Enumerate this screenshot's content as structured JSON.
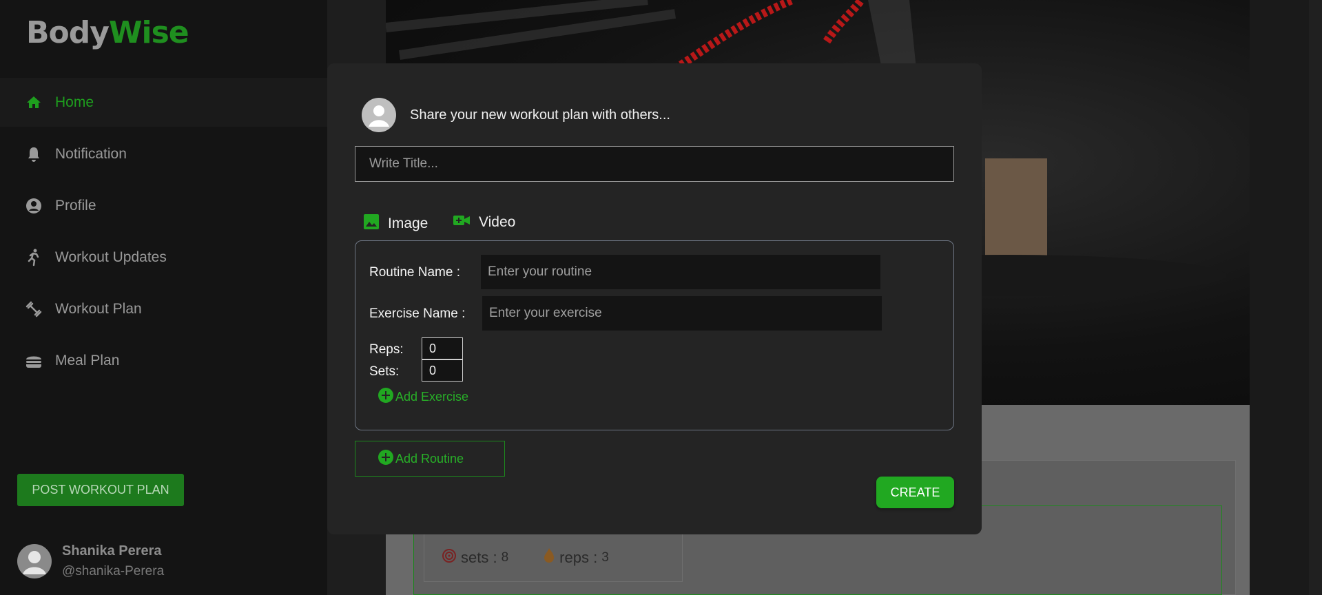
{
  "app": {
    "logo_part1": "Body",
    "logo_part2": "Wise"
  },
  "sidebar": {
    "items": [
      {
        "label": "Home",
        "icon": "home-icon",
        "active": true
      },
      {
        "label": "Notification",
        "icon": "bell-icon"
      },
      {
        "label": "Profile",
        "icon": "user-circle-icon"
      },
      {
        "label": "Workout Updates",
        "icon": "running-icon"
      },
      {
        "label": "Workout Plan",
        "icon": "dumbbell-icon"
      },
      {
        "label": "Meal Plan",
        "icon": "burger-icon"
      }
    ],
    "post_button": "POST WORKOUT PLAN",
    "user": {
      "name": "Shanika Perera",
      "handle": "@shanika-Perera"
    }
  },
  "background": {
    "stats": {
      "sets_label": "sets :",
      "sets_value": "8",
      "reps_label": "reps :",
      "reps_value": "3"
    }
  },
  "modal": {
    "heading": "Share your new workout plan with others...",
    "title_placeholder": "Write Title...",
    "image_label": "Image",
    "video_label": "Video",
    "routine_name_label": "Routine Name :",
    "routine_placeholder": "Enter your routine",
    "exercise_name_label": "Exercise Name :",
    "exercise_placeholder": "Enter your exercise",
    "reps_label": "Reps:",
    "reps_value": "0",
    "sets_label": "Sets:",
    "sets_value": "0",
    "add_exercise": "Add Exercise",
    "add_routine": "Add Routine",
    "create_button": "CREATE"
  },
  "colors": {
    "accent": "#21a821",
    "sidebar": "#141414",
    "modal": "#242424"
  }
}
